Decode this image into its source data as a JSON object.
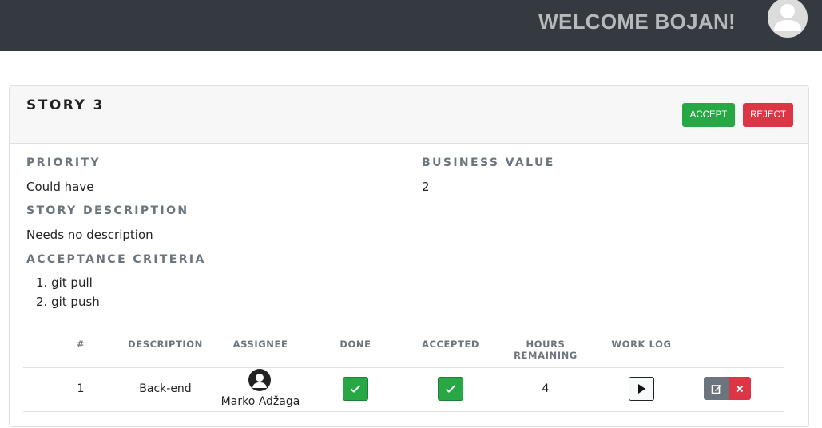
{
  "header": {
    "welcome_text": "WELCOME BOJAN!",
    "avatar_icon": "user-circle-icon"
  },
  "story": {
    "title": "STORY 3",
    "accept_label": "ACCEPT",
    "reject_label": "REJECT",
    "priority_label": "PRIORITY",
    "priority_value": "Could have",
    "business_value_label": "BUSINESS VALUE",
    "business_value": "2",
    "description_label": "STORY DESCRIPTION",
    "description_value": "Needs no description",
    "criteria_label": "ACCEPTANCE CRITERIA",
    "criteria": [
      "1. git pull",
      "2. git push"
    ]
  },
  "tasks_table": {
    "columns": [
      "#",
      "DESCRIPTION",
      "ASSIGNEE",
      "DONE",
      "ACCEPTED",
      "HOURS REMAINING",
      "WORK LOG"
    ],
    "rows": [
      {
        "number": "1",
        "description": "Back-end",
        "assignee": "Marko Adžaga",
        "done": true,
        "accepted": true,
        "hours_remaining": "4",
        "work_log_icon": "play-icon",
        "actions": [
          "edit-icon",
          "delete-icon"
        ]
      }
    ]
  },
  "colors": {
    "topbar": "#343a40",
    "success": "#28a745",
    "danger": "#dc3545",
    "secondary": "#6c757d"
  }
}
